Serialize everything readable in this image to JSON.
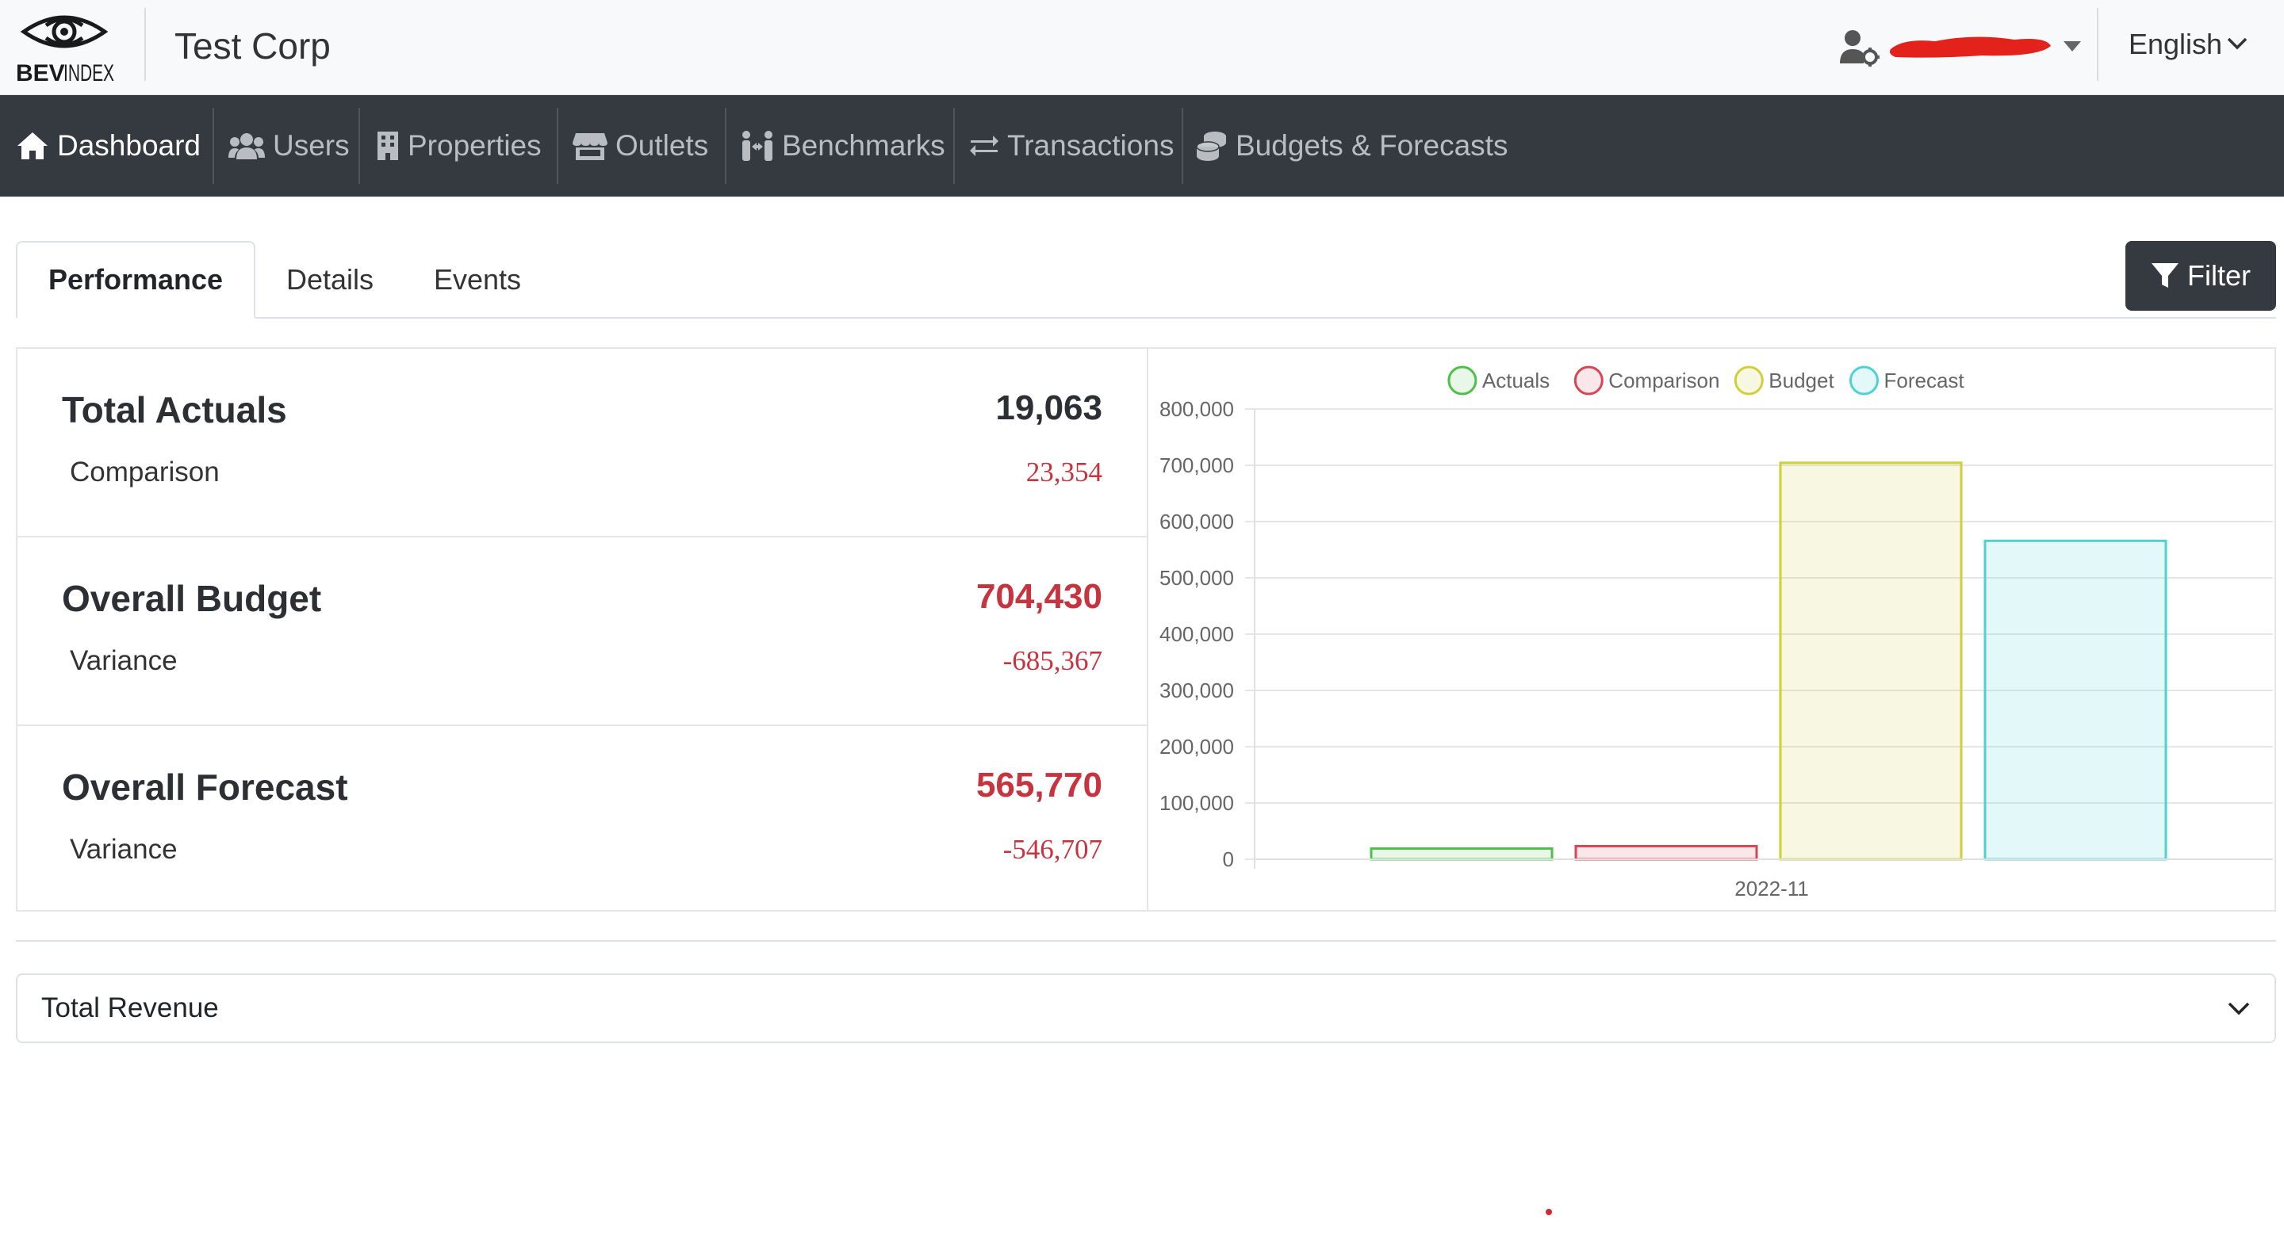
{
  "brand": {
    "logo_text": "BEVINDEX",
    "company": "Test Corp"
  },
  "header": {
    "language": "English"
  },
  "nav": [
    {
      "label": "Dashboard",
      "icon": "home-icon",
      "active": true
    },
    {
      "label": "Users",
      "icon": "users-icon"
    },
    {
      "label": "Properties",
      "icon": "building-icon"
    },
    {
      "label": "Outlets",
      "icon": "store-icon"
    },
    {
      "label": "Benchmarks",
      "icon": "people-arrows-icon"
    },
    {
      "label": "Transactions",
      "icon": "exchange-icon"
    },
    {
      "label": "Budgets & Forecasts",
      "icon": "coins-icon"
    }
  ],
  "tabs": [
    {
      "label": "Performance",
      "active": true
    },
    {
      "label": "Details"
    },
    {
      "label": "Events"
    }
  ],
  "filter_label": "Filter",
  "summary": {
    "actuals": {
      "title": "Total Actuals",
      "value": "19,063",
      "sub_label": "Comparison",
      "sub_value": "23,354"
    },
    "budget": {
      "title": "Overall Budget",
      "value": "704,430",
      "sub_label": "Variance",
      "sub_value": "-685,367"
    },
    "forecast": {
      "title": "Overall Forecast",
      "value": "565,770",
      "sub_label": "Variance",
      "sub_value": "-546,707"
    }
  },
  "colors": {
    "actuals": "#4bc04b",
    "comparison": "#d94452",
    "budget": "#cfcf3a",
    "forecast": "#4fd1d4",
    "negative": "#c6343f",
    "navbar": "#343a40"
  },
  "chart_data": {
    "type": "bar",
    "categories": [
      "2022-11"
    ],
    "series": [
      {
        "name": "Actuals",
        "values": [
          19063
        ]
      },
      {
        "name": "Comparison",
        "values": [
          23354
        ]
      },
      {
        "name": "Budget",
        "values": [
          704430
        ]
      },
      {
        "name": "Forecast",
        "values": [
          565770
        ]
      }
    ],
    "ylim": [
      0,
      800000
    ],
    "yticks": [
      "800,000",
      "700,000",
      "600,000",
      "500,000",
      "400,000",
      "300,000",
      "200,000",
      "100,000",
      "0"
    ],
    "ytick_values": [
      800000,
      700000,
      600000,
      500000,
      400000,
      300000,
      200000,
      100000,
      0
    ],
    "legend_position": "top",
    "grid": true
  },
  "accordion": {
    "label": "Total Revenue"
  }
}
